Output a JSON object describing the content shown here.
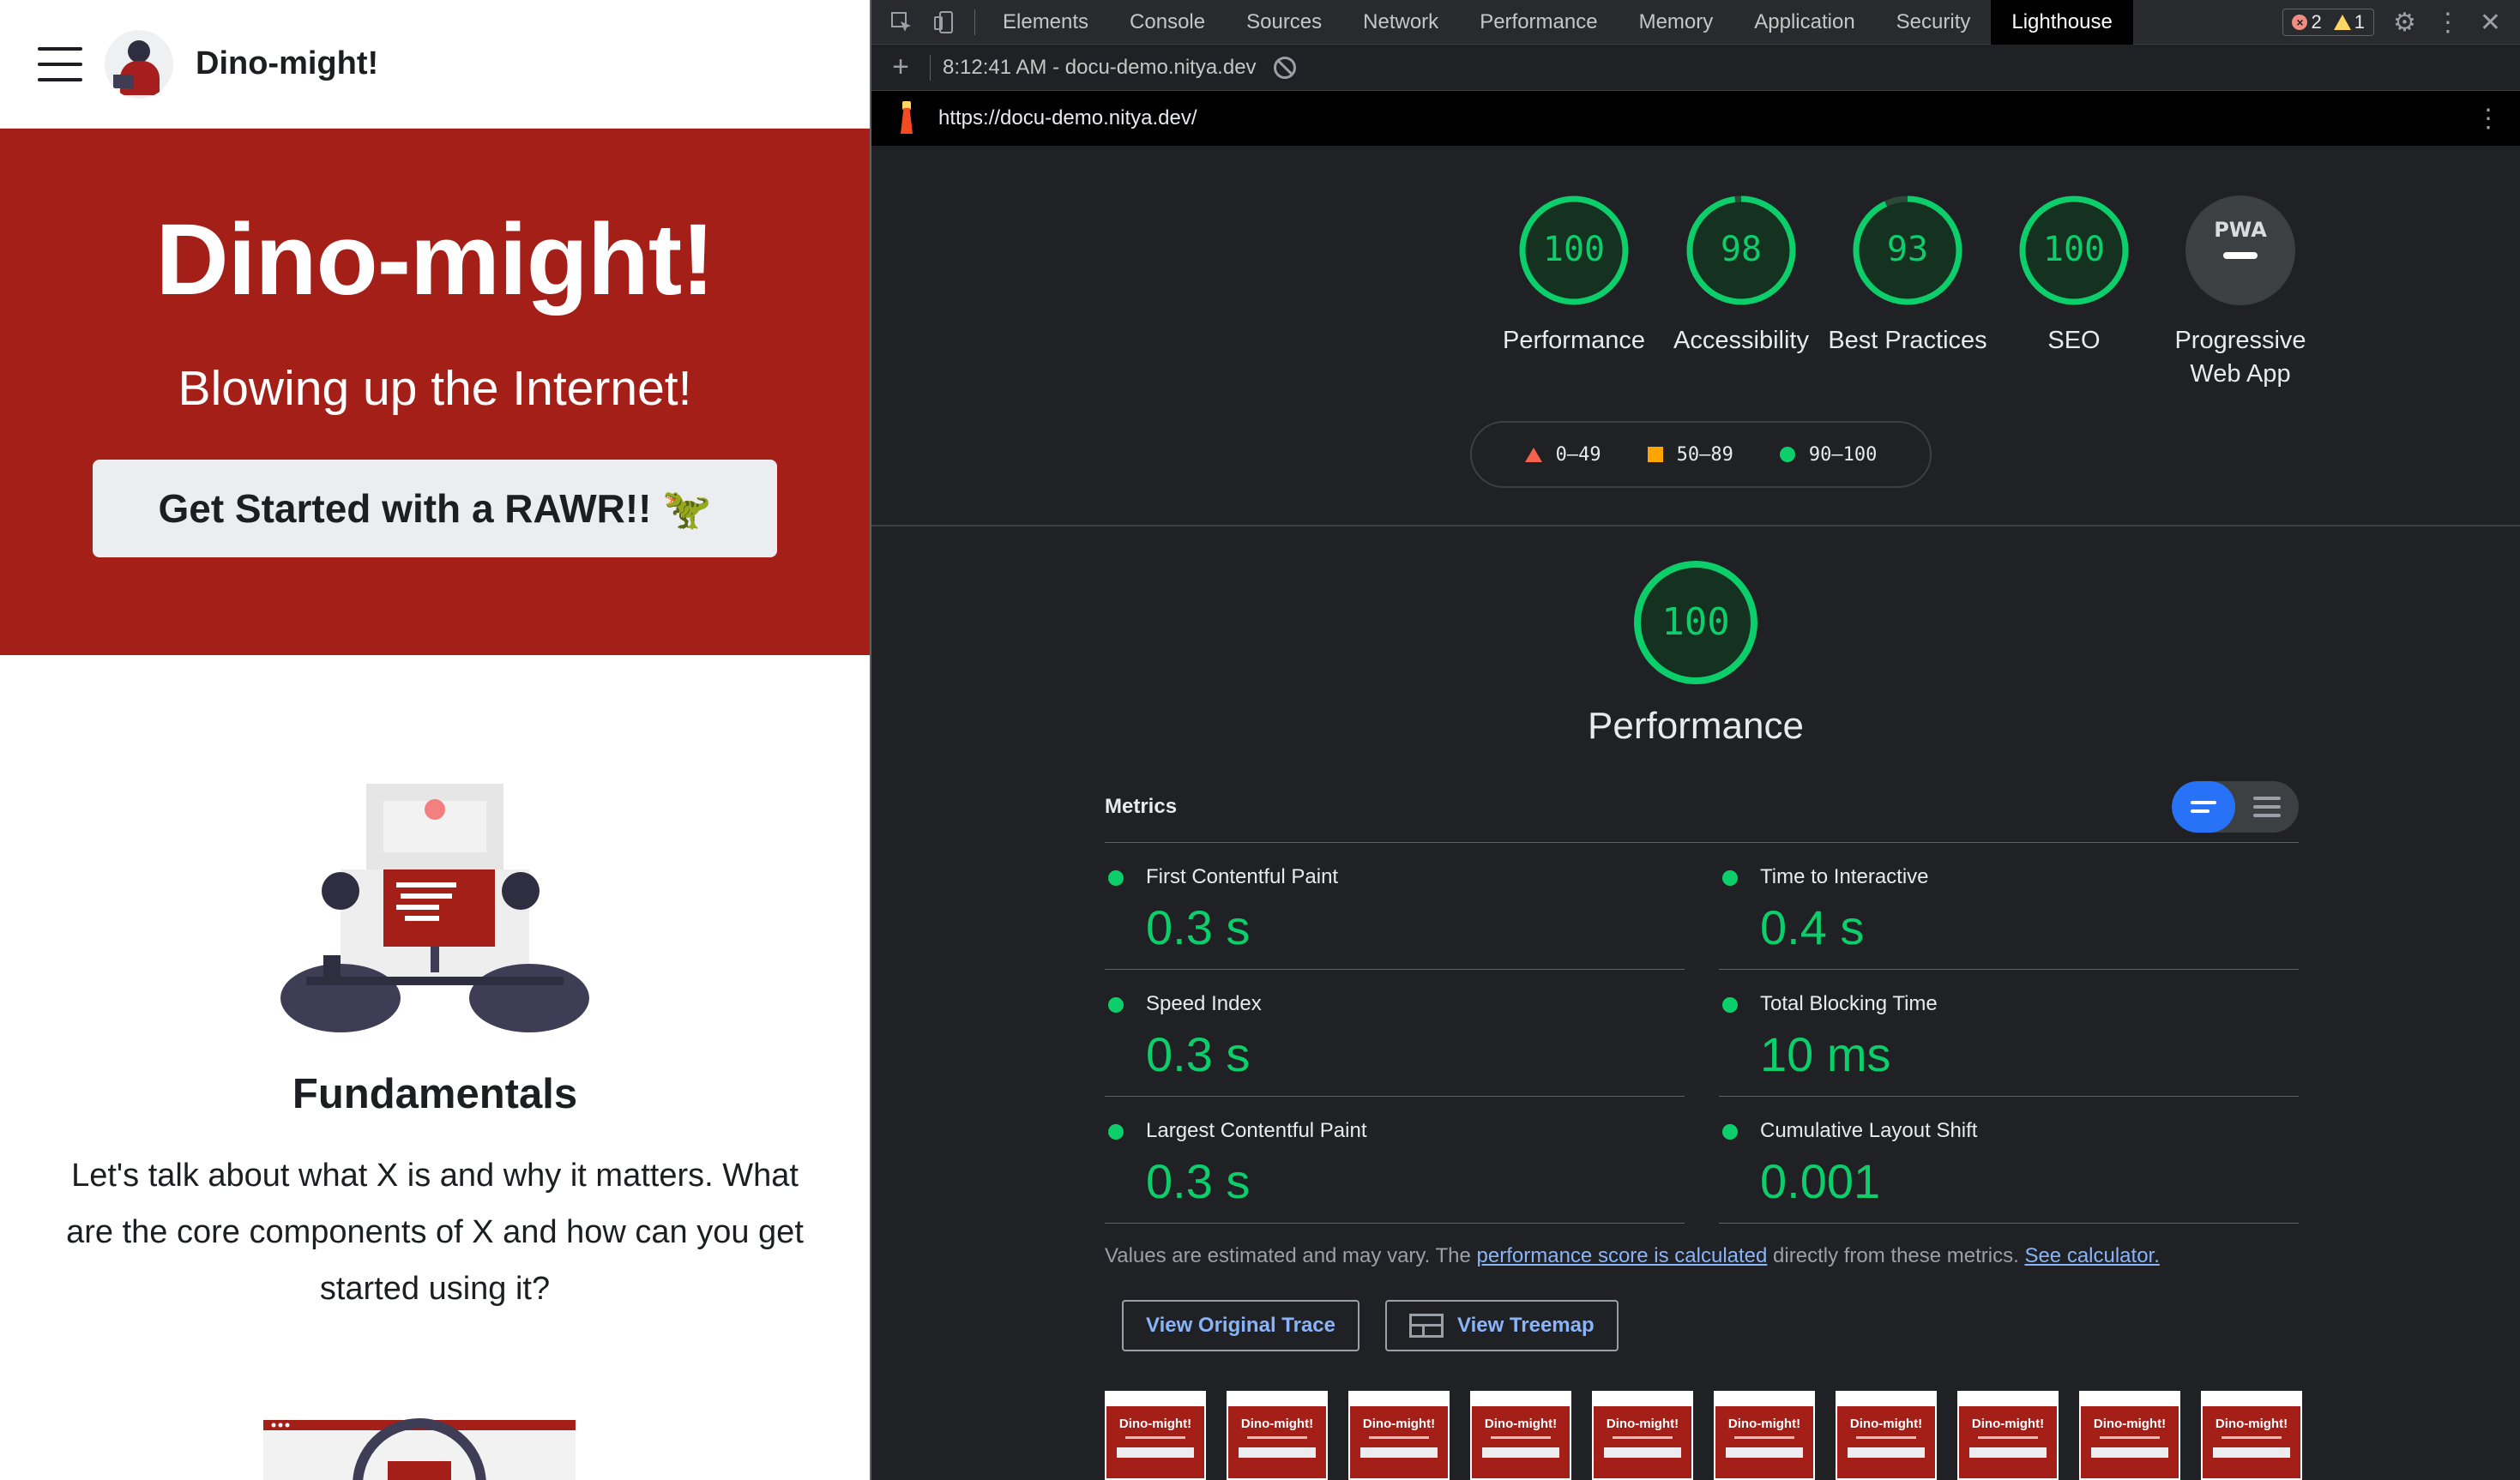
{
  "site": {
    "brand": "Dino-might!",
    "hero_title": "Dino-might!",
    "hero_tagline": "Blowing up the Internet!",
    "cta_label": "Get Started with a RAWR!! 🦖",
    "section_title": "Fundamentals",
    "section_text": "Let's talk about what X is and why it matters. What are the core components of X and how can you get started using it?"
  },
  "devtools": {
    "tabs": [
      "Elements",
      "Console",
      "Sources",
      "Network",
      "Performance",
      "Memory",
      "Application",
      "Security",
      "Lighthouse"
    ],
    "active_tab": "Lighthouse",
    "error_count": "2",
    "warning_count": "1",
    "report_select": "8:12:41 AM - docu-demo.nitya.dev ▾",
    "url": "https://docu-demo.nitya.dev/"
  },
  "lighthouse": {
    "categories": [
      {
        "label": "Performance",
        "score": "100"
      },
      {
        "label": "Accessibility",
        "score": "98"
      },
      {
        "label": "Best Practices",
        "score": "93"
      },
      {
        "label": "SEO",
        "score": "100"
      },
      {
        "label": "Progressive Web App",
        "score": "PWA"
      }
    ],
    "legend": [
      "0–49",
      "50–89",
      "90–100"
    ],
    "colors": {
      "pass": "#0cce6b",
      "average": "#ffa400",
      "fail": "#f4614f",
      "accent": "#2872f7"
    },
    "section_score": "100",
    "section_title": "Performance",
    "metrics_title": "Metrics",
    "metrics": [
      {
        "name": "First Contentful Paint",
        "value": "0.3 s"
      },
      {
        "name": "Time to Interactive",
        "value": "0.4 s"
      },
      {
        "name": "Speed Index",
        "value": "0.3 s"
      },
      {
        "name": "Total Blocking Time",
        "value": "10 ms"
      },
      {
        "name": "Largest Contentful Paint",
        "value": "0.3 s"
      },
      {
        "name": "Cumulative Layout Shift",
        "value": "0.001"
      }
    ],
    "note_prefix": "Values are estimated and may vary. The ",
    "note_link1": "performance score is calculated",
    "note_middle": " directly from these metrics. ",
    "note_link2": "See calculator.",
    "btn_trace": "View Original Trace",
    "btn_treemap": "View Treemap",
    "thumb_title": "Dino-might!"
  }
}
